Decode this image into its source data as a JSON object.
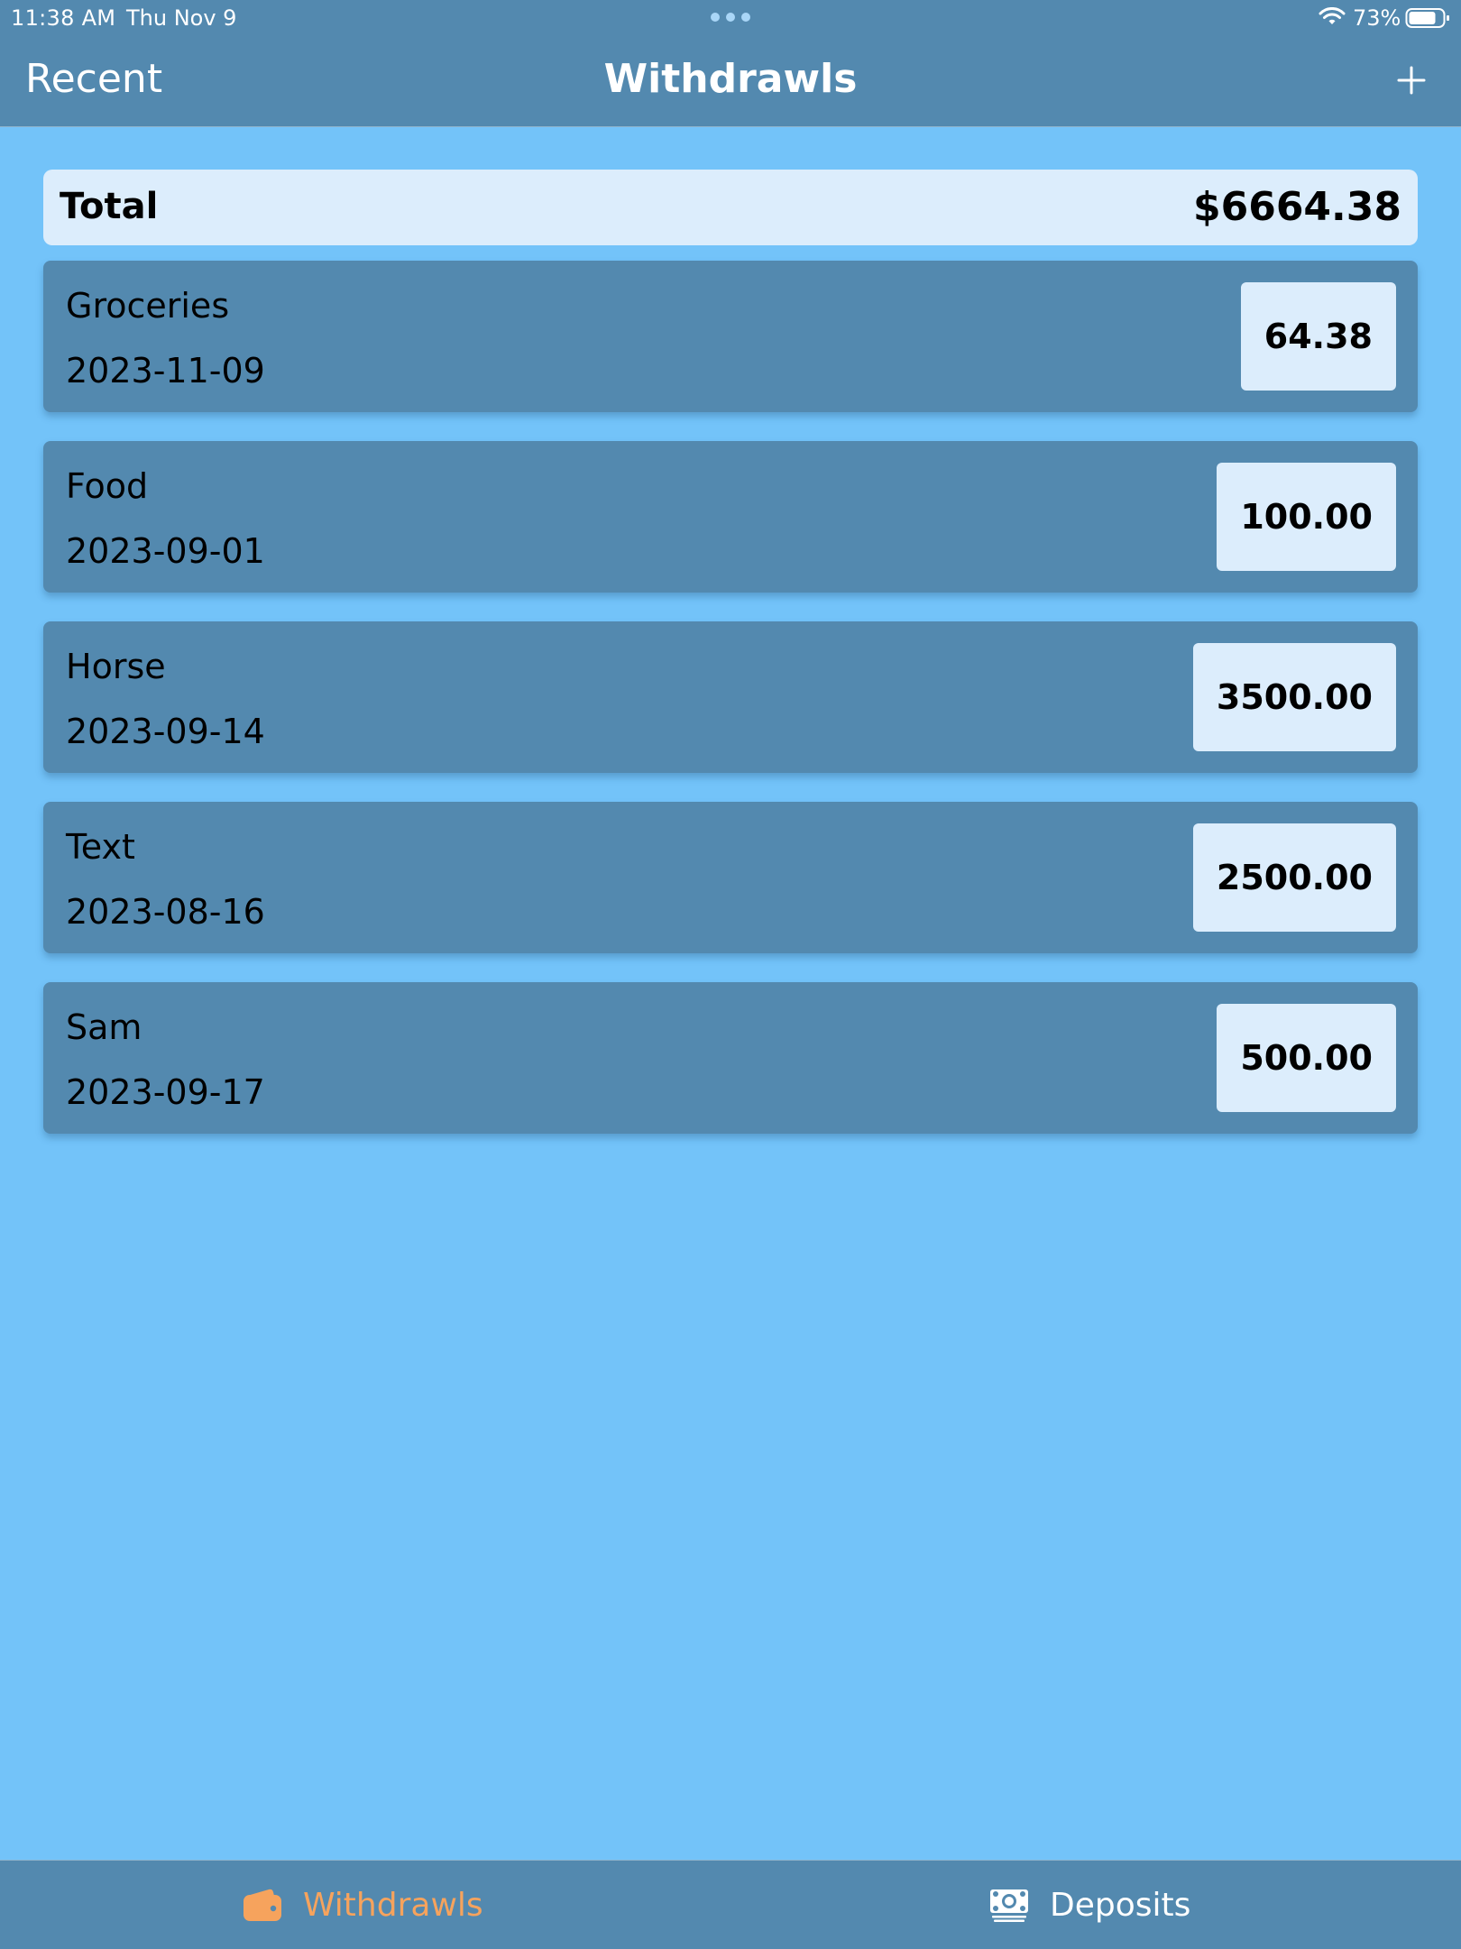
{
  "status_bar": {
    "time": "11:38 AM",
    "date": "Thu Nov 9",
    "battery": "73%",
    "icons": [
      "wifi-icon",
      "battery-icon"
    ]
  },
  "nav": {
    "back_label": "Recent",
    "title": "Withdrawls",
    "add_icon": "plus-icon"
  },
  "total": {
    "label": "Total",
    "value": "$6664.38"
  },
  "withdrawals": [
    {
      "name": "Groceries",
      "date": "2023-11-09",
      "amount": "64.38"
    },
    {
      "name": "Food",
      "date": "2023-09-01",
      "amount": "100.00"
    },
    {
      "name": "Horse",
      "date": "2023-09-14",
      "amount": "3500.00"
    },
    {
      "name": "Text",
      "date": "2023-08-16",
      "amount": "2500.00"
    },
    {
      "name": "Sam",
      "date": "2023-09-17",
      "amount": "500.00"
    }
  ],
  "tab_bar": {
    "tabs": [
      {
        "label": "Withdrawls",
        "icon": "wallet-icon",
        "selected": true
      },
      {
        "label": "Deposits",
        "icon": "banknote-icon",
        "selected": false
      }
    ]
  },
  "colors": {
    "background": "#73c3f9",
    "bar": "#5389af",
    "card": "#dcedfc",
    "accent_selected": "#f6a35d"
  }
}
